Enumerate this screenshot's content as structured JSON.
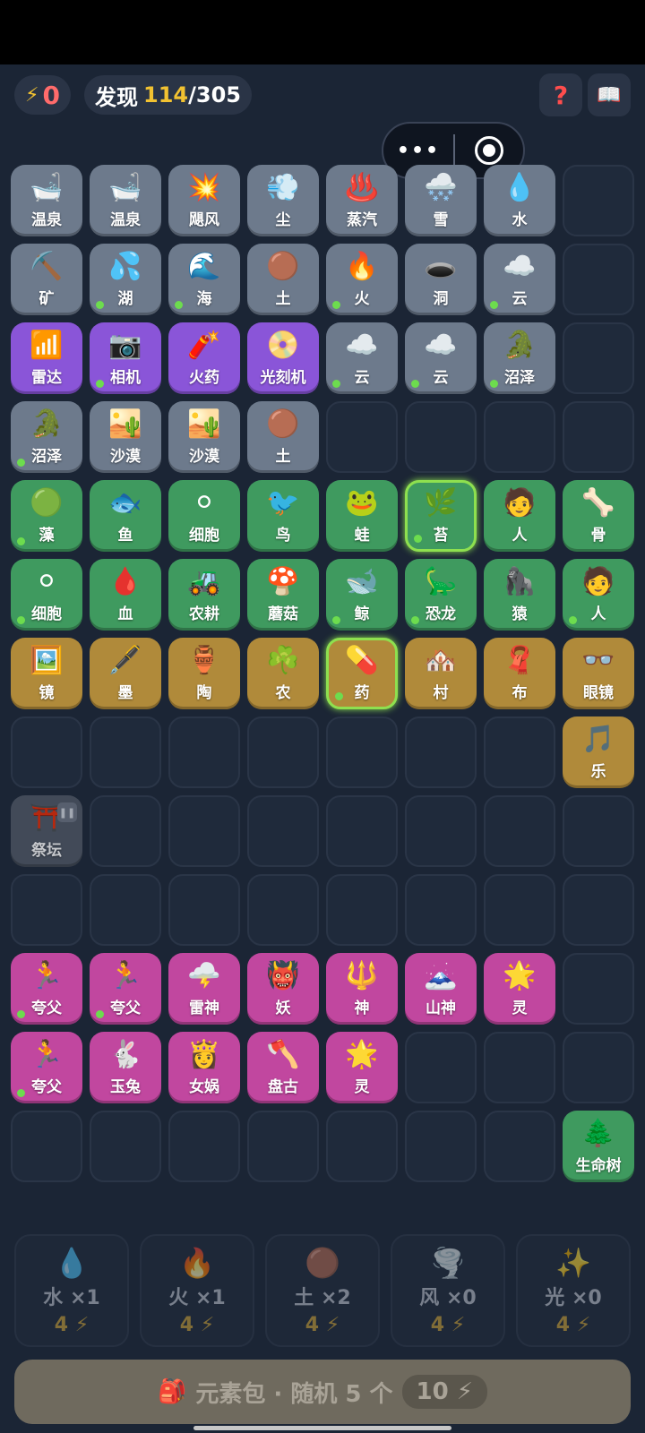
{
  "header": {
    "energy": "0",
    "discover_label": "发现",
    "discover_found": "114",
    "discover_sep": "/",
    "discover_total": "305"
  },
  "colors": {
    "gray": "#6d7a8c",
    "purple": "#8a55d8",
    "green": "#3f9a5f",
    "gold": "#b08a3a",
    "pink": "#c1479f",
    "accent": "#f2c231",
    "new_dot": "#6ddc4e"
  },
  "grid": [
    {
      "label": "温泉",
      "icon": "🛁",
      "c": "gray"
    },
    {
      "label": "温泉",
      "icon": "🛁",
      "c": "gray"
    },
    {
      "label": "飓风",
      "icon": "💥",
      "c": "gray"
    },
    {
      "label": "尘",
      "icon": "💨",
      "c": "gray"
    },
    {
      "label": "蒸汽",
      "icon": "♨️",
      "c": "gray"
    },
    {
      "label": "雪",
      "icon": "🌨️",
      "c": "gray"
    },
    {
      "label": "水",
      "icon": "💧",
      "c": "gray"
    },
    {
      "c": "empty"
    },
    {
      "label": "矿",
      "icon": "⛏️",
      "c": "gray"
    },
    {
      "label": "湖",
      "icon": "💦",
      "c": "gray",
      "dot": true
    },
    {
      "label": "海",
      "icon": "🌊",
      "c": "gray",
      "dot": true
    },
    {
      "label": "土",
      "icon": "🟤",
      "c": "gray"
    },
    {
      "label": "火",
      "icon": "🔥",
      "c": "gray",
      "dot": true
    },
    {
      "label": "洞",
      "icon": "🕳️",
      "c": "gray"
    },
    {
      "label": "云",
      "icon": "☁️",
      "c": "gray",
      "dot": true
    },
    {
      "c": "empty"
    },
    {
      "label": "雷达",
      "icon": "📶",
      "c": "purple"
    },
    {
      "label": "相机",
      "icon": "📷",
      "c": "purple",
      "dot": true
    },
    {
      "label": "火药",
      "icon": "🧨",
      "c": "purple"
    },
    {
      "label": "光刻机",
      "icon": "📀",
      "c": "purple"
    },
    {
      "label": "云",
      "icon": "☁️",
      "c": "gray",
      "dot": true
    },
    {
      "label": "云",
      "icon": "☁️",
      "c": "gray",
      "dot": true
    },
    {
      "label": "沼泽",
      "icon": "🐊",
      "c": "gray",
      "dot": true
    },
    {
      "c": "empty"
    },
    {
      "label": "沼泽",
      "icon": "🐊",
      "c": "gray",
      "dot": true
    },
    {
      "label": "沙漠",
      "icon": "🏜️",
      "c": "gray"
    },
    {
      "label": "沙漠",
      "icon": "🏜️",
      "c": "gray"
    },
    {
      "label": "土",
      "icon": "🟤",
      "c": "gray"
    },
    {
      "c": "empty"
    },
    {
      "c": "empty"
    },
    {
      "c": "empty"
    },
    {
      "c": "empty"
    },
    {
      "label": "藻",
      "icon": "🟢",
      "c": "green",
      "dot": true
    },
    {
      "label": "鱼",
      "icon": "🐟",
      "c": "green"
    },
    {
      "label": "细胞",
      "icon": "⚪",
      "c": "green"
    },
    {
      "label": "鸟",
      "icon": "🐦",
      "c": "green"
    },
    {
      "label": "蛙",
      "icon": "🐸",
      "c": "green"
    },
    {
      "label": "苔",
      "icon": "🌿",
      "c": "green",
      "dot": true,
      "sel": true
    },
    {
      "label": "人",
      "icon": "🧑",
      "c": "green"
    },
    {
      "label": "骨",
      "icon": "🦴",
      "c": "green"
    },
    {
      "label": "细胞",
      "icon": "⚪",
      "c": "green",
      "dot": true
    },
    {
      "label": "血",
      "icon": "🩸",
      "c": "green"
    },
    {
      "label": "农耕",
      "icon": "🚜",
      "c": "green"
    },
    {
      "label": "蘑菇",
      "icon": "🍄",
      "c": "green"
    },
    {
      "label": "鲸",
      "icon": "🐋",
      "c": "green",
      "dot": true
    },
    {
      "label": "恐龙",
      "icon": "🦕",
      "c": "green",
      "dot": true
    },
    {
      "label": "猿",
      "icon": "🦍",
      "c": "green"
    },
    {
      "label": "人",
      "icon": "🧑",
      "c": "green",
      "dot": true
    },
    {
      "label": "镜",
      "icon": "🖼️",
      "c": "gold"
    },
    {
      "label": "墨",
      "icon": "🖋️",
      "c": "gold"
    },
    {
      "label": "陶",
      "icon": "🏺",
      "c": "gold"
    },
    {
      "label": "农",
      "icon": "☘️",
      "c": "gold"
    },
    {
      "label": "药",
      "icon": "💊",
      "c": "gold",
      "dot": true,
      "sel": true
    },
    {
      "label": "村",
      "icon": "🏘️",
      "c": "gold"
    },
    {
      "label": "布",
      "icon": "🧣",
      "c": "gold"
    },
    {
      "label": "眼镜",
      "icon": "👓",
      "c": "gold"
    },
    {
      "c": "empty"
    },
    {
      "c": "empty"
    },
    {
      "c": "empty"
    },
    {
      "c": "empty"
    },
    {
      "c": "empty"
    },
    {
      "c": "empty"
    },
    {
      "c": "empty"
    },
    {
      "label": "乐",
      "icon": "🎵",
      "c": "gold"
    },
    {
      "label": "祭坛",
      "icon": "⛩️",
      "c": "dim",
      "paused": true
    },
    {
      "c": "empty"
    },
    {
      "c": "empty"
    },
    {
      "c": "empty"
    },
    {
      "c": "empty"
    },
    {
      "c": "empty"
    },
    {
      "c": "empty"
    },
    {
      "c": "empty"
    },
    {
      "c": "empty"
    },
    {
      "c": "empty"
    },
    {
      "c": "empty"
    },
    {
      "c": "empty"
    },
    {
      "c": "empty"
    },
    {
      "c": "empty"
    },
    {
      "c": "empty"
    },
    {
      "c": "empty"
    },
    {
      "label": "夸父",
      "icon": "🏃",
      "c": "pink",
      "dot": true
    },
    {
      "label": "夸父",
      "icon": "🏃",
      "c": "pink",
      "dot": true
    },
    {
      "label": "雷神",
      "icon": "🌩️",
      "c": "pink"
    },
    {
      "label": "妖",
      "icon": "👹",
      "c": "pink"
    },
    {
      "label": "神",
      "icon": "🔱",
      "c": "pink"
    },
    {
      "label": "山神",
      "icon": "🗻",
      "c": "pink"
    },
    {
      "label": "灵",
      "icon": "🌟",
      "c": "pink"
    },
    {
      "c": "empty"
    },
    {
      "label": "夸父",
      "icon": "🏃",
      "c": "pink",
      "dot": true
    },
    {
      "label": "玉兔",
      "icon": "🐇",
      "c": "pink"
    },
    {
      "label": "女娲",
      "icon": "👸",
      "c": "pink"
    },
    {
      "label": "盘古",
      "icon": "🪓",
      "c": "pink"
    },
    {
      "label": "灵",
      "icon": "🌟",
      "c": "pink"
    },
    {
      "c": "empty"
    },
    {
      "c": "empty"
    },
    {
      "c": "empty"
    },
    {
      "c": "empty"
    },
    {
      "c": "empty"
    },
    {
      "c": "empty"
    },
    {
      "c": "empty"
    },
    {
      "c": "empty"
    },
    {
      "c": "empty"
    },
    {
      "c": "empty"
    },
    {
      "label": "生命树",
      "icon": "🌲",
      "c": "green"
    }
  ],
  "shop": [
    {
      "icon": "💧",
      "name": "水 ×1",
      "cost": "4 ⚡"
    },
    {
      "icon": "🔥",
      "name": "火 ×1",
      "cost": "4 ⚡"
    },
    {
      "icon": "🟤",
      "name": "土 ×2",
      "cost": "4 ⚡"
    },
    {
      "icon": "🌪️",
      "name": "风 ×0",
      "cost": "4 ⚡"
    },
    {
      "icon": "✨",
      "name": "光 ×0",
      "cost": "4 ⚡"
    }
  ],
  "pack": {
    "icon": "🎒",
    "label": "元素包 · 随机 5 个",
    "cost": "10 ⚡"
  }
}
